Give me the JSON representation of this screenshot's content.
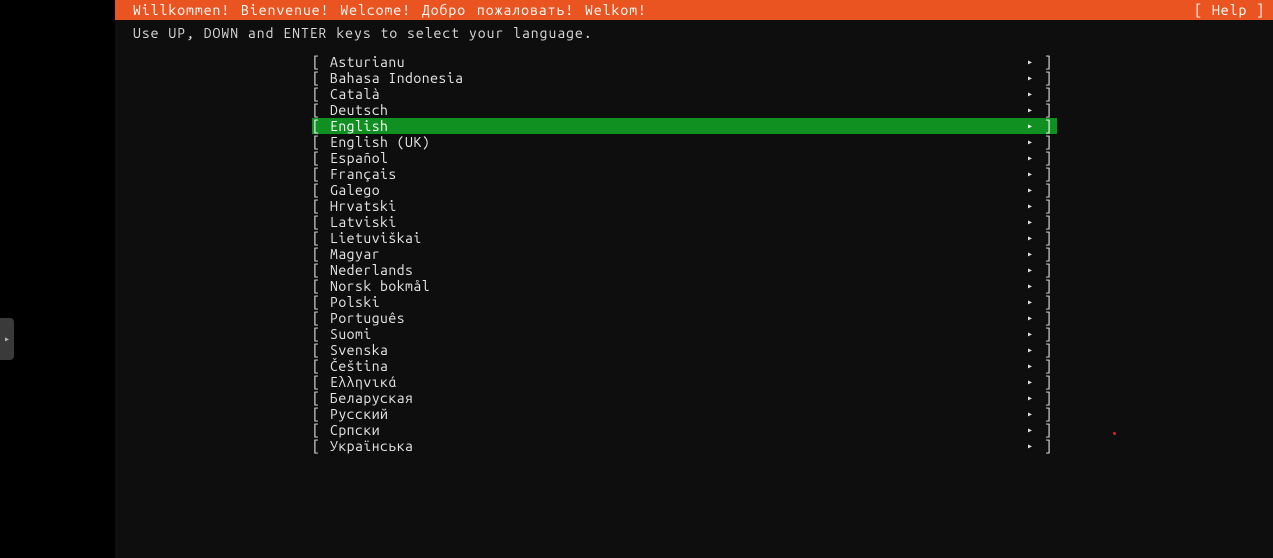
{
  "header": {
    "title": "Willkommen! Bienvenue! Welcome! Добро пожаловать! Welkom!",
    "help": "[ Help ]"
  },
  "instruction": "Use UP, DOWN and ENTER keys to select your language.",
  "bracket_open": "[ ",
  "bracket_close": "]",
  "arrow_glyph": "▸",
  "selected_index": 4,
  "languages": [
    {
      "label": "Asturianu"
    },
    {
      "label": "Bahasa Indonesia"
    },
    {
      "label": "Català"
    },
    {
      "label": "Deutsch"
    },
    {
      "label": "English"
    },
    {
      "label": "English (UK)"
    },
    {
      "label": "Español"
    },
    {
      "label": "Français"
    },
    {
      "label": "Galego"
    },
    {
      "label": "Hrvatski"
    },
    {
      "label": "Latviski"
    },
    {
      "label": "Lietuviškai"
    },
    {
      "label": "Magyar"
    },
    {
      "label": "Nederlands"
    },
    {
      "label": "Norsk bokmål"
    },
    {
      "label": "Polski"
    },
    {
      "label": "Português"
    },
    {
      "label": "Suomi"
    },
    {
      "label": "Svenska"
    },
    {
      "label": "Čeština"
    },
    {
      "label": "Ελληνικά"
    },
    {
      "label": "Беларуская"
    },
    {
      "label": "Русский"
    },
    {
      "label": "Српски"
    },
    {
      "label": "Українська"
    }
  ]
}
